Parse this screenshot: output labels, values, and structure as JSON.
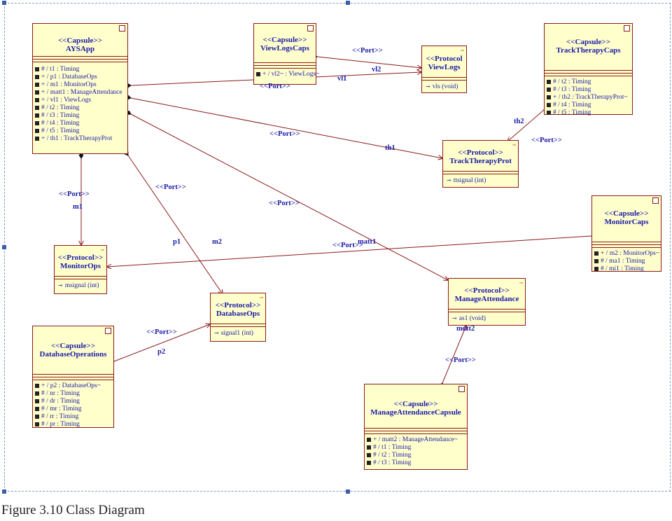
{
  "caption": "Figure 3.10 Class Diagram",
  "colors": {
    "box_fill": "#ffffcc",
    "box_border": "#8b1a1a",
    "text": "#1a1aa8",
    "line": "#8b1a1a"
  },
  "boxes": {
    "aysapp": {
      "stereotype": "<<Capsule>>",
      "name": "AYSApp",
      "attrs": [
        "# / t1 : Timing",
        "+ / p1 : DatabaseOps",
        "+ / m1 : MonitorOps",
        "+ / matt1 : ManageAttendance",
        "+ / vl1 : ViewLogs",
        "# / t2 : Timing",
        "# / t3 : Timing",
        "# / t4 : Timing",
        "# / t5 : Timing",
        "+ / th1 : TrackTherapyProt"
      ]
    },
    "viewlogscaps": {
      "stereotype": "<<Capsule>>",
      "name": "ViewLogsCaps",
      "attrs": [
        "+ / vl2~ : ViewLogs~"
      ]
    },
    "viewlogs": {
      "stereotype": "<<Protocol",
      "name": "ViewLogs",
      "ops": [
        "vls (void)"
      ]
    },
    "tracktherapycaps": {
      "stereotype": "<<Capsule>>",
      "name": "TrackTherapyCaps",
      "attrs": [
        "# / t2 : Timing",
        "# / t3 : Timing",
        "+ / th2 : TrackTherapyProt~",
        "# / t4 : Timing",
        "# / t5 : Timing"
      ]
    },
    "tracktherapyprot": {
      "stereotype": "<<Protocol>>",
      "name": "TrackTherapyProt",
      "ops": [
        "ttsignal (int)"
      ]
    },
    "monitorcaps": {
      "stereotype": "<<Capsule>>",
      "name": "MonitorCaps",
      "attrs": [
        "+ / m2 : MonitorOps~",
        "# / ma1 : Timing",
        "# / mi1 : Timing"
      ]
    },
    "monitorops": {
      "stereotype": "<<Protocol>>",
      "name": "MonitorOps",
      "ops": [
        "msignal (int)"
      ]
    },
    "databaseops": {
      "stereotype": "<<Protocol>>",
      "name": "DatabaseOps",
      "ops": [
        "signal1 (int)"
      ]
    },
    "manageattendance": {
      "stereotype": "<<Protocol>>",
      "name": "ManageAttendance",
      "ops": [
        "as1 (void)"
      ]
    },
    "databaseoperations": {
      "stereotype": "<<Capsule>>",
      "name": "DatabaseOperations",
      "attrs": [
        "+ / p2 : DatabaseOps~",
        "# / nr : Timing",
        "# / dr : Timing",
        "# / mr : Timing",
        "# / rr : Timing",
        "# / pr : Timing"
      ]
    },
    "manageattendancecapsule": {
      "stereotype": "<<Capsule>>",
      "name": "ManageAttendanceCapsule",
      "attrs": [
        "+ / matt2 : ManageAttendance~",
        "# / t1 : Timing",
        "# / t2 : Timing",
        "# / t3 : Timing"
      ]
    }
  },
  "labels": {
    "port_vl": "<<Port>>",
    "vl2": "vl2",
    "vl1": "vl1",
    "port_vlcaps": "<<Port>>",
    "port_th1": "<<Port>>",
    "th1": "th1",
    "th2": "th2",
    "port_th2": "<<Port>>",
    "port_m1": "<<Port>>",
    "m1": "m1",
    "port_p1": "<<Port>>",
    "p1": "p1",
    "m2": "m2",
    "port_matt1": "<<Port>>",
    "port_m2": "<<Port>>",
    "matt1": "matt1",
    "port_p2": "<<Port>>",
    "p2": "p2",
    "matt2": "matt2",
    "port_matt2": "<<Port>>"
  }
}
